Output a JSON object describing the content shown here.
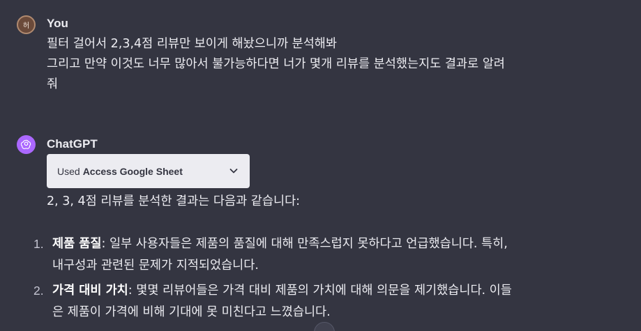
{
  "user_message": {
    "author": "You",
    "avatar_text": "허",
    "lines": [
      "필터 걸어서 2,3,4점 리뷰만 보이게 해놨으니까 분석해봐",
      "그리고 만약 이것도 너무 많아서 불가능하다면 너가 몇개 리뷰를 분석했는지도 결과로 알려",
      "줘"
    ]
  },
  "assistant_message": {
    "author": "ChatGPT",
    "avatar_icon": "openai-logo-icon",
    "avatar_color": "#ab68ff",
    "tool_used": {
      "prefix": "Used",
      "name": "Access Google Sheet",
      "icon": "chevron-down-icon"
    },
    "intro": "2, 3, 4점 리뷰를 분석한 결과는 다음과 같습니다:",
    "items": [
      {
        "number": "1.",
        "title": "제품 품질",
        "line1": ": 일부 사용자들은 제품의 품질에 대해 만족스럽지 못하다고 언급했습니다. 특히,",
        "line2": "내구성과 관련된 문제가 지적되었습니다."
      },
      {
        "number": "2.",
        "title": "가격 대비 가치",
        "line1": ": 몇몇 리뷰어들은 가격 대비 제품의 가치에 대해 의문을 제기했습니다. 이들",
        "line2": "은 제품이 가격에 비해 기대에 못 미친다고 느꼈습니다."
      }
    ]
  },
  "colors": {
    "background": "#343541",
    "text": "#ececf1",
    "tool_box": "#ececf1"
  }
}
